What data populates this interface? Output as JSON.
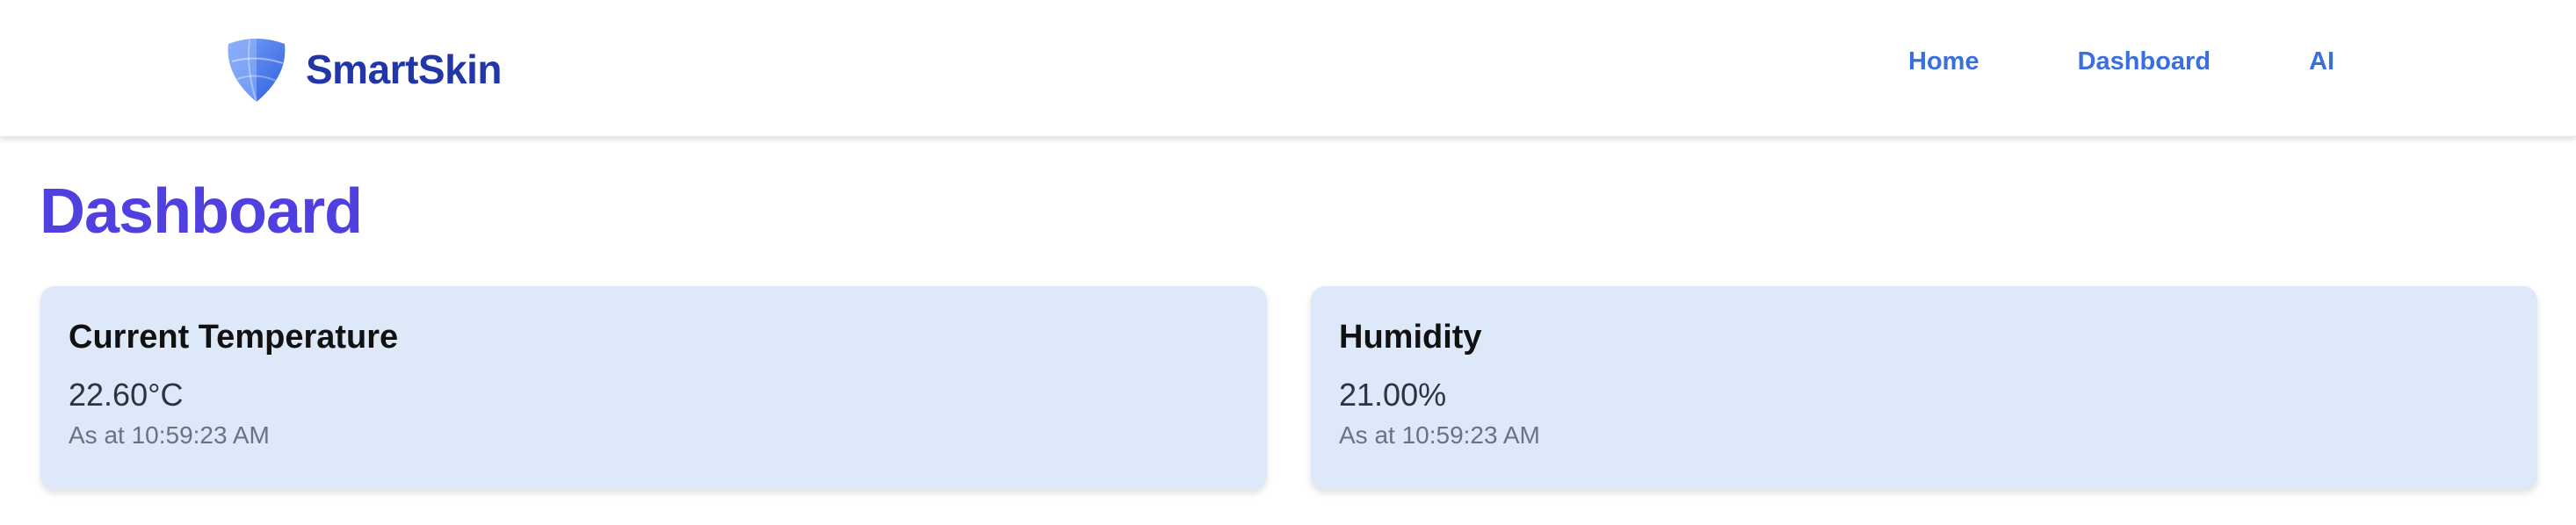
{
  "brand": {
    "name": "SmartSkin",
    "logo_icon": "shield-logo-icon",
    "colors": {
      "primary": "#2336a8",
      "light": "#6f95f5",
      "mid": "#3f6be8"
    }
  },
  "nav": {
    "items": [
      {
        "label": "Home"
      },
      {
        "label": "Dashboard"
      },
      {
        "label": "AI"
      }
    ],
    "color": "#3b6fe0"
  },
  "page": {
    "title": "Dashboard",
    "title_color": "#5040e0"
  },
  "cards": [
    {
      "title": "Current Temperature",
      "value": "22.60°C",
      "timestamp": "As at 10:59:23 AM"
    },
    {
      "title": "Humidity",
      "value": "21.00%",
      "timestamp": "As at 10:59:23 AM"
    }
  ],
  "card_background": "#dde8f9"
}
